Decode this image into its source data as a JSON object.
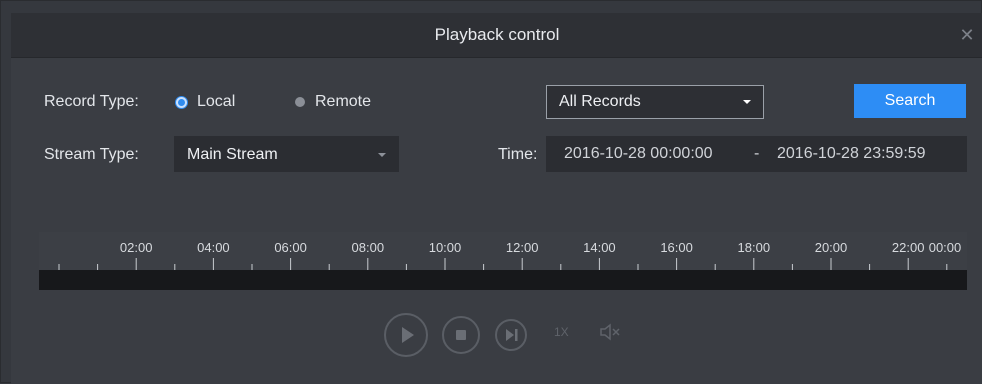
{
  "window": {
    "title": "Playback control",
    "close_glyph": "✕"
  },
  "record_type": {
    "label": "Record Type:",
    "options": [
      {
        "label": "Local",
        "selected": true
      },
      {
        "label": "Remote",
        "selected": false
      }
    ]
  },
  "records_filter": {
    "value": "All Records"
  },
  "search": {
    "label": "Search"
  },
  "stream_type": {
    "label": "Stream Type:",
    "value": "Main Stream"
  },
  "time": {
    "label": "Time:",
    "start": "2016-10-28 00:00:00",
    "separator": "-",
    "end": "2016-10-28 23:59:59"
  },
  "timeline": {
    "hour_labels": [
      "02:00",
      "04:00",
      "06:00",
      "08:00",
      "10:00",
      "12:00",
      "14:00",
      "16:00",
      "18:00",
      "20:00",
      "22:00",
      "00:00"
    ]
  },
  "playback": {
    "play_icon": "play-icon",
    "stop_icon": "stop-icon",
    "next_frame_icon": "next-frame-icon",
    "speed": "1X",
    "mute_icon": "speaker-muted-icon"
  },
  "colors": {
    "accent": "#2d8df5",
    "background": "#3a3d43",
    "titlebar": "#2e3035",
    "field": "#2b2d32",
    "track": "#17181b"
  }
}
